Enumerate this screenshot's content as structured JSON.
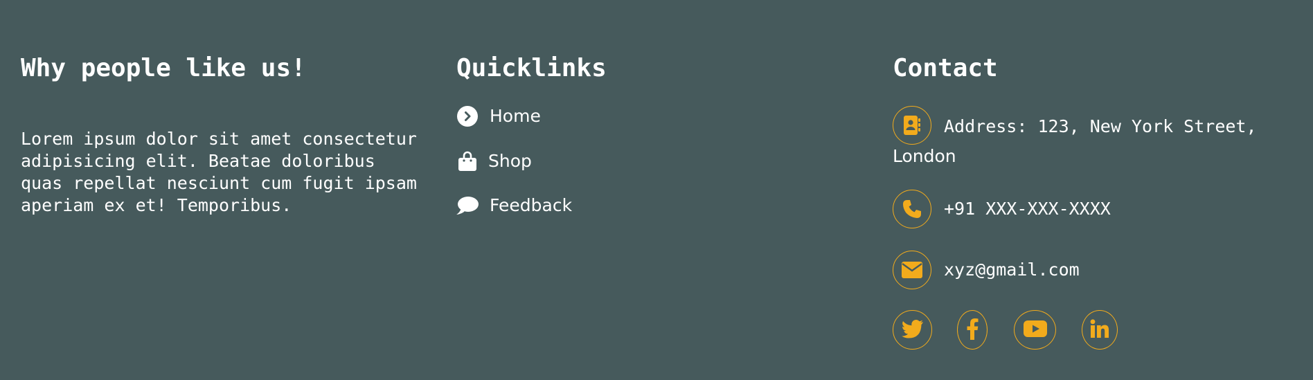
{
  "about": {
    "heading": "Why people like us!",
    "text": "Lorem ipsum dolor sit amet consectetur adipisicing elit. Beatae doloribus quas repellat nesciunt cum fugit ipsam aperiam ex et! Temporibus."
  },
  "quicklinks": {
    "heading": "Quicklinks",
    "items": [
      {
        "label": "Home",
        "icon": "chevron-right-circle-icon"
      },
      {
        "label": "Shop",
        "icon": "shopping-bag-icon"
      },
      {
        "label": "Feedback",
        "icon": "comment-icon"
      }
    ]
  },
  "contact": {
    "heading": "Contact",
    "address_line1": "Address: 123, New York Street,",
    "address_line2": "London",
    "phone": "+91 XXX-XXX-XXXX",
    "email": "xyz@gmail.com",
    "social": [
      "twitter-icon",
      "facebook-icon",
      "youtube-icon",
      "linkedin-icon"
    ]
  },
  "colors": {
    "background": "#465a5c",
    "accent": "#f2ab1c",
    "text": "#ffffff"
  }
}
